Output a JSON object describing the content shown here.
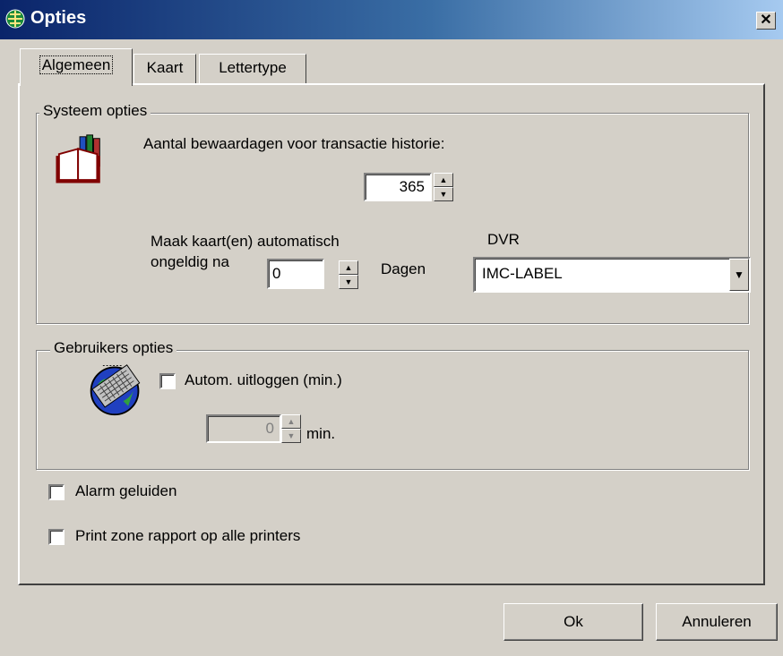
{
  "window": {
    "title": "Opties",
    "close_symbol": "✕"
  },
  "tabs": [
    {
      "label": "Algemeen",
      "active": true
    },
    {
      "label": "Kaart",
      "active": false
    },
    {
      "label": "Lettertype",
      "active": false
    }
  ],
  "systeem": {
    "legend": "Systeem opties",
    "history_label": "Aantal bewaardagen voor transactie historie:",
    "history_value": "365",
    "invalid_label_line1": "Maak kaart(en) automatisch",
    "invalid_label_line2": "ongeldig na",
    "invalid_value": "0",
    "invalid_unit": "Dagen",
    "dvr_label": "DVR",
    "dvr_value": "IMC-LABEL"
  },
  "gebruikers": {
    "legend": "Gebruikers opties",
    "autologout_label": "Autom. uitloggen (min.)",
    "autologout_checked": false,
    "minutes_value": "0",
    "minutes_unit": "min."
  },
  "options": {
    "alarm_label": "Alarm geluiden",
    "alarm_checked": false,
    "print_label": "Print zone rapport op alle printers",
    "print_checked": false
  },
  "buttons": {
    "ok": "Ok",
    "cancel": "Annuleren"
  },
  "colors": {
    "titlebar_start": "#0a246a",
    "titlebar_end": "#a6caf0",
    "face": "#d4d0c8"
  }
}
